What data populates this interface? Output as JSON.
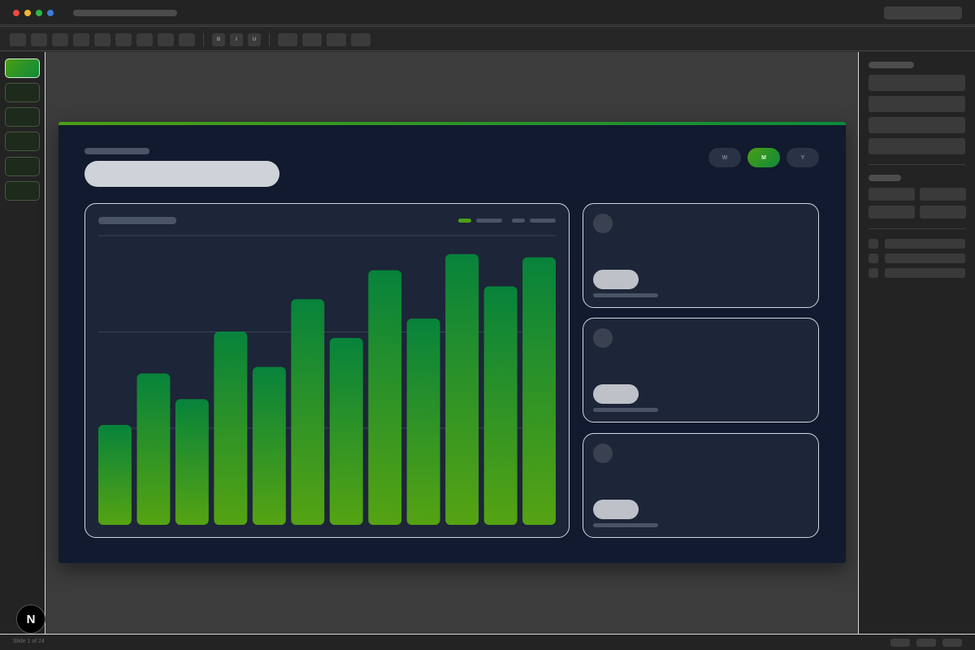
{
  "window": {
    "traffic_lights": [
      "#ed4b3d",
      "#f2b82a",
      "#2fb84a",
      "#3d7bd9"
    ]
  },
  "slide": {
    "period_tabs": [
      {
        "label": "W",
        "active": false
      },
      {
        "label": "M",
        "active": true
      },
      {
        "label": "Y",
        "active": false
      }
    ],
    "accent_colors": [
      "#4b9f14",
      "#0d8a3b"
    ]
  },
  "toolbar": {
    "format_buttons": [
      "B",
      "I",
      "U"
    ]
  },
  "chart_data": {
    "type": "bar",
    "values": [
      31,
      47,
      39,
      60,
      49,
      70,
      58,
      79,
      64,
      84,
      74,
      83
    ],
    "ylim": [
      0,
      90
    ],
    "grid": true,
    "colors": {
      "top": "#07833b",
      "bottom": "#55a312"
    }
  },
  "status": {
    "slide_indicator": "Slide 1 of 24"
  },
  "badge": {
    "letter": "N"
  }
}
